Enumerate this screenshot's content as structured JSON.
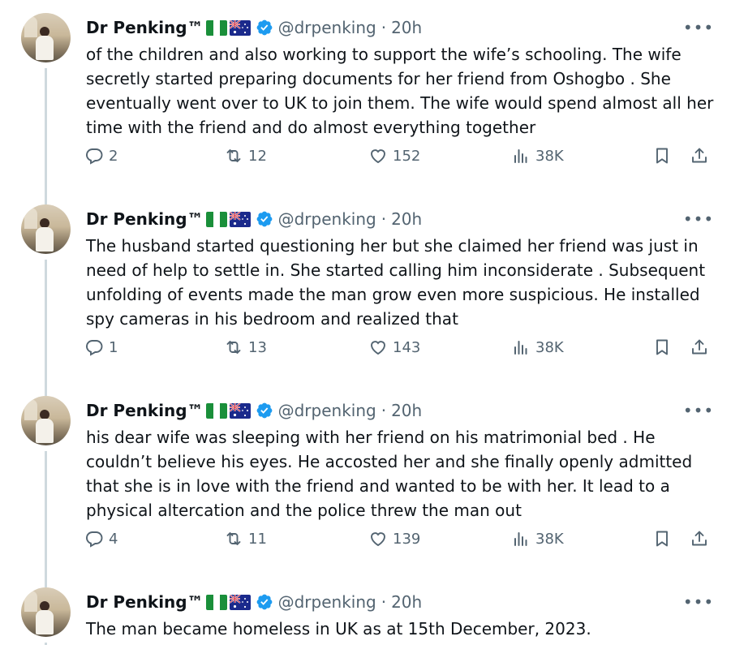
{
  "author": {
    "name": "Dr Penking™",
    "handle": "@drpenking",
    "separator": "·",
    "time": "20h"
  },
  "tweets": [
    {
      "text": "of the children and also working to support the wife’s schooling. The wife secretly started preparing documents for her friend from Oshogbo . She eventually went over to UK to join them. The wife would spend almost all her time with the friend and do almost everything together",
      "replies": "2",
      "reposts": "12",
      "likes": "152",
      "views": "38K"
    },
    {
      "text": "The husband started questioning her but she claimed her friend was just in need of help to settle in. She started calling him inconsiderate . Subsequent unfolding of events made the man grow even more suspicious. He installed spy cameras in his bedroom and realized that",
      "replies": "1",
      "reposts": "13",
      "likes": "143",
      "views": "38K"
    },
    {
      "text": "his dear wife was sleeping with her friend on his matrimonial bed . He couldn’t believe his eyes. He accosted her and she finally openly admitted that she is in love with the friend and wanted to be with her. It lead to a physical altercation and the police threw the man out",
      "replies": "4",
      "reposts": "11",
      "likes": "139",
      "views": "38K"
    },
    {
      "text": "The man became homeless in UK as at 15th December, 2023."
    }
  ],
  "icons": {
    "reply": "reply-icon",
    "repost": "repost-icon",
    "like": "heart-icon",
    "views": "views-icon",
    "bookmark": "bookmark-icon",
    "share": "share-icon",
    "more": "more-icon",
    "verified": "verified-badge-icon",
    "flag1": "nigeria-flag-icon",
    "flag2": "australia-flag-icon"
  },
  "colors": {
    "verified": "#1d9bf0",
    "muted": "#536471",
    "thread_line": "#cfd9de",
    "nigeria_green": "#1a8f3a"
  }
}
